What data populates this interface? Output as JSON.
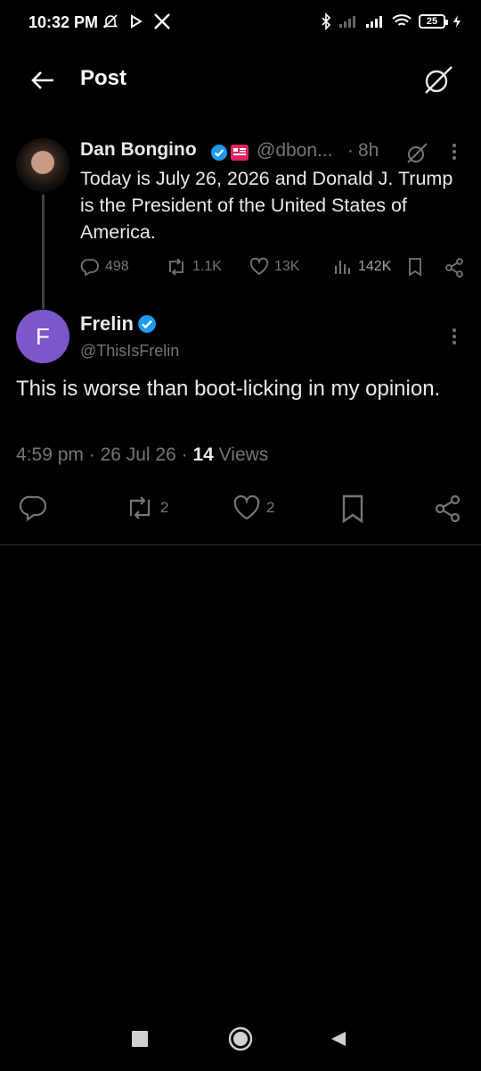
{
  "status_bar": {
    "time": "10:32 PM",
    "battery": "25"
  },
  "header": {
    "title": "Post"
  },
  "parent_tweet": {
    "name": "Dan Bongino",
    "handle": "@dbon...",
    "separator": "·",
    "time": "8h",
    "text": "Today is July 26, 2026 and Donald J. Trump is the President of the United States of America.",
    "replies": "498",
    "reposts": "1.1K",
    "likes": "13K",
    "views": "142K"
  },
  "main_tweet": {
    "avatar_letter": "F",
    "name": "Frelin",
    "handle": "@ThisIsFrelin",
    "text": "This is worse than boot-licking in my opinion.",
    "time": "4:59 pm",
    "date": "26 Jul 26",
    "views_count": "14",
    "views_label": "Views",
    "reposts": "2",
    "likes": "2"
  },
  "colors": {
    "background": "#000000",
    "text": "#e7e9ea",
    "secondary": "#71767b",
    "verified": "#1d9bf0",
    "avatar_f": "#7b57c9"
  }
}
